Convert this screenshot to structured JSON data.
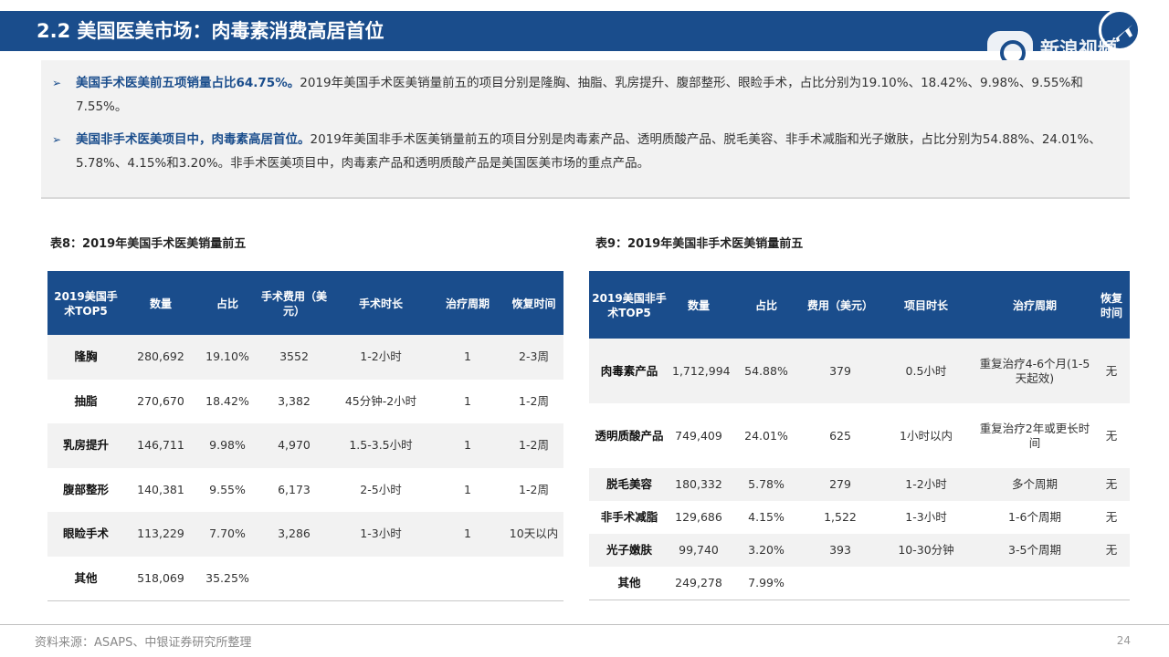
{
  "header": {
    "title": "2.2 美国医美市场：肉毒素消费高居首位",
    "watermark": "新浪视频"
  },
  "summary": {
    "bullets": [
      {
        "highlight": "美国手术医美前五项销量占比64.75%。",
        "text": "2019年美国手术医美销量前五的项目分别是隆胸、抽脂、乳房提升、腹部整形、眼睑手术，占比分别为19.10%、18.42%、9.98%、9.55%和7.55%。"
      },
      {
        "highlight": "美国非手术医美项目中，肉毒素高居首位。",
        "text": "2019年美国非手术医美销量前五的项目分别是肉毒素产品、透明质酸产品、脱毛美容、非手术减脂和光子嫩肤，占比分别为54.88%、24.01%、5.78%、4.15%和3.20%。非手术医美项目中，肉毒素产品和透明质酸产品是美国医美市场的重点产品。"
      }
    ]
  },
  "table8": {
    "caption": "表8：2019年美国手术医美销量前五",
    "headers": [
      "2019美国手术TOP5",
      "数量",
      "占比",
      "手术费用（美元）",
      "手术时长",
      "治疗周期",
      "恢复时间"
    ],
    "rows": [
      [
        "隆胸",
        "280,692",
        "19.10%",
        "3552",
        "1-2小时",
        "1",
        "2-3周"
      ],
      [
        "抽脂",
        "270,670",
        "18.42%",
        "3,382",
        "45分钟-2小时",
        "1",
        "1-2周"
      ],
      [
        "乳房提升",
        "146,711",
        "9.98%",
        "4,970",
        "1.5-3.5小时",
        "1",
        "1-2周"
      ],
      [
        "腹部整形",
        "140,381",
        "9.55%",
        "6,173",
        "2-5小时",
        "1",
        "1-2周"
      ],
      [
        "眼睑手术",
        "113,229",
        "7.70%",
        "3,286",
        "1-3小时",
        "1",
        "10天以内"
      ],
      [
        "其他",
        "518,069",
        "35.25%",
        "",
        "",
        "",
        ""
      ]
    ]
  },
  "table9": {
    "caption": "表9：2019年美国非手术医美销量前五",
    "headers": [
      "2019美国非手术TOP5",
      "数量",
      "占比",
      "费用（美元）",
      "项目时长",
      "治疗周期",
      "恢复时间"
    ],
    "rows": [
      [
        "肉毒素产品",
        "1,712,994",
        "54.88%",
        "379",
        "0.5小时",
        "重复治疗4-6个月(1-5天起效)",
        "无"
      ],
      [
        "透明质酸产品",
        "749,409",
        "24.01%",
        "625",
        "1小时以内",
        "重复治疗2年或更长时间",
        "无"
      ],
      [
        "脱毛美容",
        "180,332",
        "5.78%",
        "279",
        "1-2小时",
        "多个周期",
        "无"
      ],
      [
        "非手术减脂",
        "129,686",
        "4.15%",
        "1,522",
        "1-3小时",
        "1-6个周期",
        "无"
      ],
      [
        "光子嫩肤",
        "99,740",
        "3.20%",
        "393",
        "10-30分钟",
        "3-5个周期",
        "无"
      ],
      [
        "其他",
        "249,278",
        "7.99%",
        "",
        "",
        "",
        ""
      ]
    ]
  },
  "footer": {
    "source": "资料来源：ASAPS、中银证券研究所整理",
    "page": "24"
  },
  "colors": {
    "primary": "#1a4d8c",
    "panel": "#f2f2f2"
  }
}
